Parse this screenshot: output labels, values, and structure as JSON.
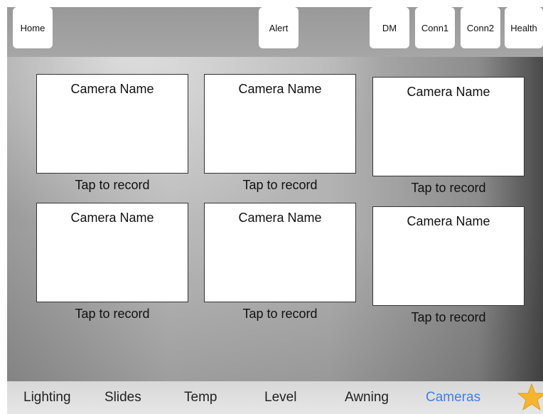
{
  "topbar": {
    "buttons": [
      {
        "label": "Home"
      },
      {
        "label": "Alert"
      },
      {
        "label": "DM"
      },
      {
        "label": "Conn1"
      },
      {
        "label": "Conn2"
      },
      {
        "label": "Health"
      }
    ]
  },
  "cameras": [
    {
      "name": "Camera Name",
      "action": "Tap to record"
    },
    {
      "name": "Camera Name",
      "action": "Tap to record"
    },
    {
      "name": "Camera Name",
      "action": "Tap to record"
    },
    {
      "name": "Camera Name",
      "action": "Tap to record"
    },
    {
      "name": "Camera Name",
      "action": "Tap to record"
    },
    {
      "name": "Camera Name",
      "action": "Tap to record"
    }
  ],
  "tabbar": {
    "tabs": [
      {
        "label": "Lighting"
      },
      {
        "label": "Slides"
      },
      {
        "label": "Temp"
      },
      {
        "label": "Level"
      },
      {
        "label": "Awning"
      },
      {
        "label": "Cameras",
        "active": true
      }
    ],
    "favorite_icon": "star-icon",
    "active_color": "#3f7ee8",
    "star_color": "#f7b52c"
  }
}
